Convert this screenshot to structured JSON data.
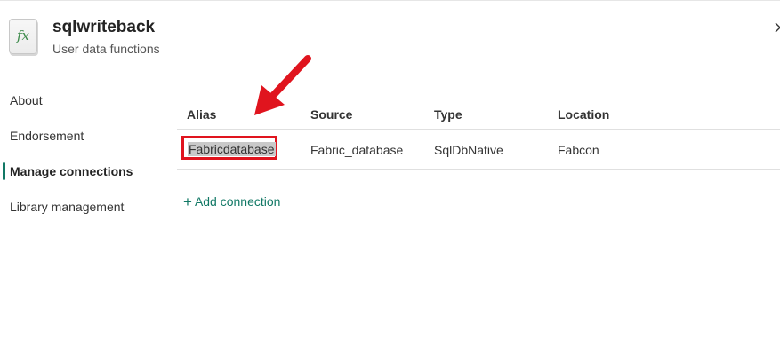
{
  "header": {
    "title": "sqlwriteback",
    "subtitle": "User data functions",
    "icon_glyph": "fx",
    "icon": "function-icon",
    "close_icon": "close-icon"
  },
  "sidebar": {
    "items": [
      {
        "label": "About",
        "active": false
      },
      {
        "label": "Endorsement",
        "active": false
      },
      {
        "label": "Manage connections",
        "active": true
      },
      {
        "label": "Library management",
        "active": false
      }
    ],
    "accent_color": "#117865"
  },
  "connections": {
    "columns": [
      "Alias",
      "Source",
      "Type",
      "Location"
    ],
    "rows": [
      {
        "alias": "Fabricdatabase",
        "source": "Fabric_database",
        "type": "SqlDbNative",
        "location": "Fabcon"
      }
    ],
    "add_label": "Add connection",
    "add_icon": "plus-icon"
  },
  "annotation": {
    "color": "#e0141e",
    "arrow_icon": "red-arrow-icon"
  }
}
